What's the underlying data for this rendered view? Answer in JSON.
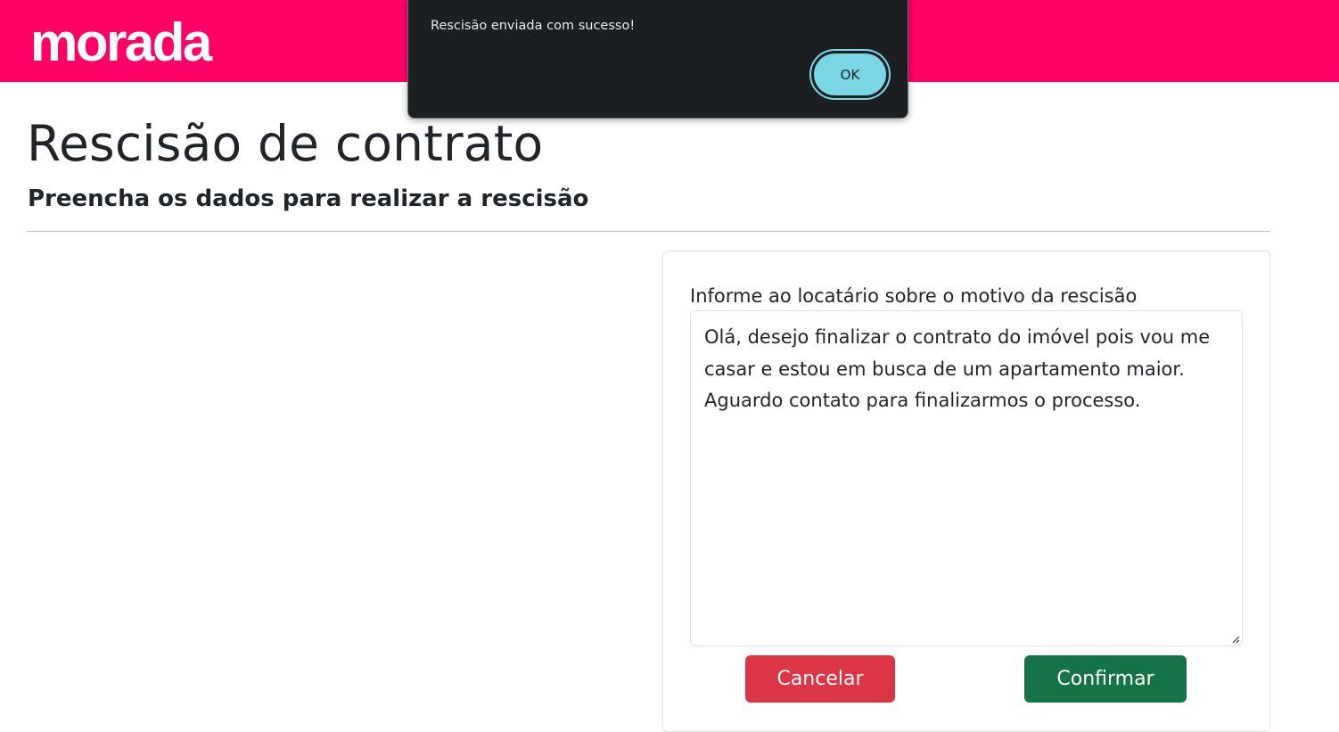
{
  "header": {
    "logo_text": "morada",
    "background_color": "#ff0066"
  },
  "page": {
    "title": "Rescisão de contrato",
    "subtitle": "Preencha os dados para realizar a rescisão"
  },
  "form": {
    "reason_label": "Informe ao locatário sobre o motivo da rescisão",
    "reason_value": "Olá, desejo finalizar o contrato do imóvel pois vou me casar e estou em busca de um apartamento maior. Aguardo contato para finalizarmos o processo.",
    "cancel_label": "Cancelar",
    "confirm_label": "Confirmar",
    "cancel_color": "#dc3545",
    "confirm_color": "#157347"
  },
  "alert": {
    "message": "Rescisão enviada com sucesso!",
    "ok_label": "OK",
    "accent_color": "#7ad6e4"
  }
}
